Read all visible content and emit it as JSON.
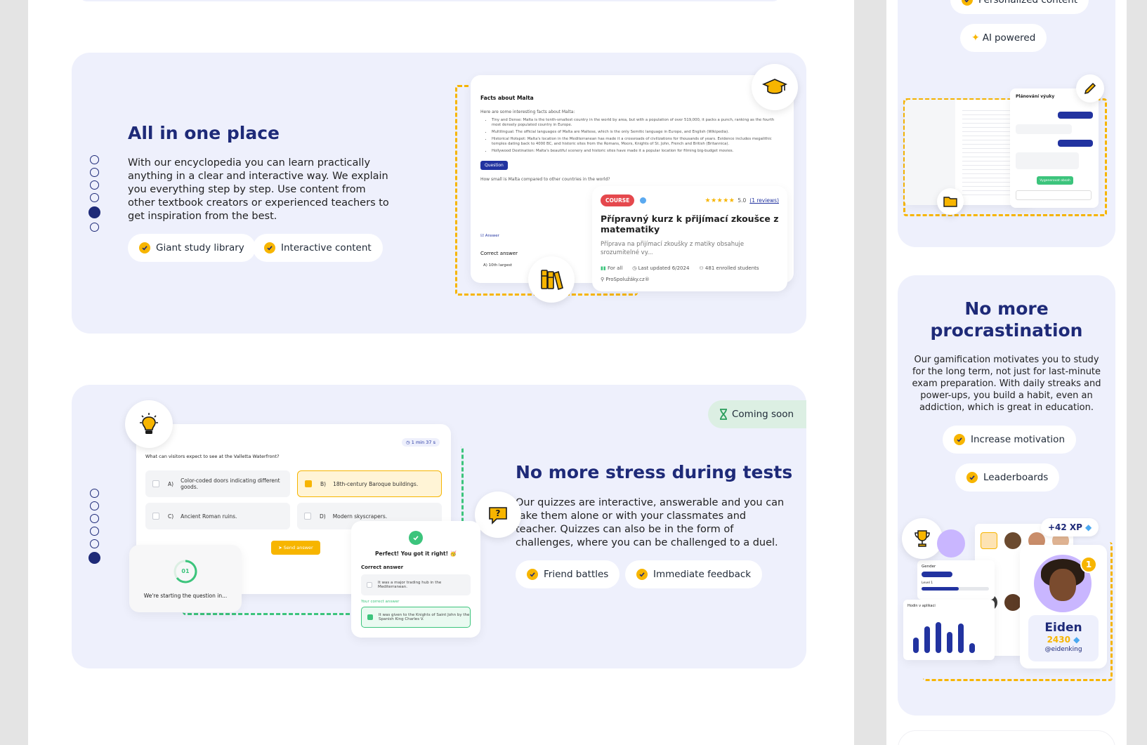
{
  "section1": {
    "title": "All in one place",
    "body": "With our encyclopedia you can learn practically anything in a clear and interactive way. We explain you everything step by step. Use content from other textbook creators or experienced teachers to get inspiration from the best.",
    "features": [
      "Giant study library",
      "Interactive content"
    ],
    "preview": {
      "doc_title": "Facts about Malta",
      "doc_intro": "Here are some interesting facts about Malta:",
      "bullets": [
        "Tiny and Dense: Malta is the tenth-smallest country in the world by area, but with a population of over 519,000, it packs a punch, ranking as the fourth most densely populated country in Europe.",
        "Multilingual: The official languages of Malta are Maltese, which is the only Semitic language in Europe, and English (Wikipedia).",
        "Historical Hotspot: Malta's location in the Mediterranean has made it a crossroads of civilizations for thousands of years. Evidence includes megalithic temples dating back to 4000 BC, and historic sites from the Romans, Moors, Knights of St. John, French and British (Britannica).",
        "Hollywood Destination: Malta's beautiful scenery and historic sites have made it a popular location for filming big-budget movies."
      ],
      "question_badge": "Question",
      "question_text": "How small is Malta compared to other countries in the world?",
      "answer_badge": "Answer",
      "correct_answer_label": "Correct answer",
      "answer_option": "A) 10th largest"
    },
    "course_card": {
      "badge": "COURSE",
      "rating": "5.0",
      "reviews": "(1 reviews)",
      "title": "Přípravný kurz k přijímací zkoušce z matematiky",
      "description": "Příprava na přijímací zkoušky z matiky obsahuje srozumitelné vy...",
      "level": "For all",
      "updated": "Last updated 6/2024",
      "enrolled": "481 enrolled students",
      "author": "ProSpolužáky.cz®"
    }
  },
  "section2": {
    "badge": "Coming soon",
    "title": "No more stress during tests",
    "body": "Our quizzes are interactive, answerable and you can take them alone or with your classmates and teacher. Quizzes can also be in the form of challenges, where you can be challenged to a duel.",
    "features": [
      "Friend battles",
      "Immediate feedback"
    ],
    "quiz": {
      "timer": "1 min 37 s",
      "question": "What can visitors expect to see at the Valletta Waterfront?",
      "options": [
        {
          "letter": "A)",
          "text": "Color-coded doors indicating different goods."
        },
        {
          "letter": "B)",
          "text": "18th-century Baroque buildings."
        },
        {
          "letter": "C)",
          "text": "Ancient Roman ruins."
        },
        {
          "letter": "D)",
          "text": "Modern skyscrapers."
        }
      ],
      "send_button": "Send answer",
      "countdown_number": "01",
      "countdown_text": "We're starting the question in...",
      "result_title": "Perfect! You got it right! 🥳",
      "correct_answer_label": "Correct answer",
      "result_option_a": "It was a major trading hub in the Mediterranean.",
      "your_correct_label": "Your correct answer",
      "result_option_b": "It was given to the Knights of Saint John by the Spanish King Charles V."
    }
  },
  "side_top": {
    "pill_personalized": "Personalized content",
    "pill_ai_icon_word": "AI",
    "pill_ai_text": "powered",
    "panel_title": "Plánování výuky",
    "panel_btn": "Vygenerovat obsah"
  },
  "side_card": {
    "title": "No more procrastination",
    "body": "Our gamification motivates you to study for the long term, not just for last-minute exam preparation. With daily streaks and power-ups, you build a habit, even an addiction, which is great in education.",
    "features": [
      "Increase motivation",
      "Leaderboards"
    ],
    "xp_badge": "+42 XP",
    "profile_name": "Eiden",
    "profile_points": "2430",
    "profile_handle": "@eidenking",
    "gender_label": "Gender",
    "level_label": "Level 1",
    "chart_label": "Hodin v aplikaci"
  },
  "colors": {
    "navy": "#1e2a78",
    "accent_yellow": "#f7b500",
    "card_bg": "#eef0fc",
    "success_green": "#3cc47c",
    "course_red": "#e5484d"
  }
}
